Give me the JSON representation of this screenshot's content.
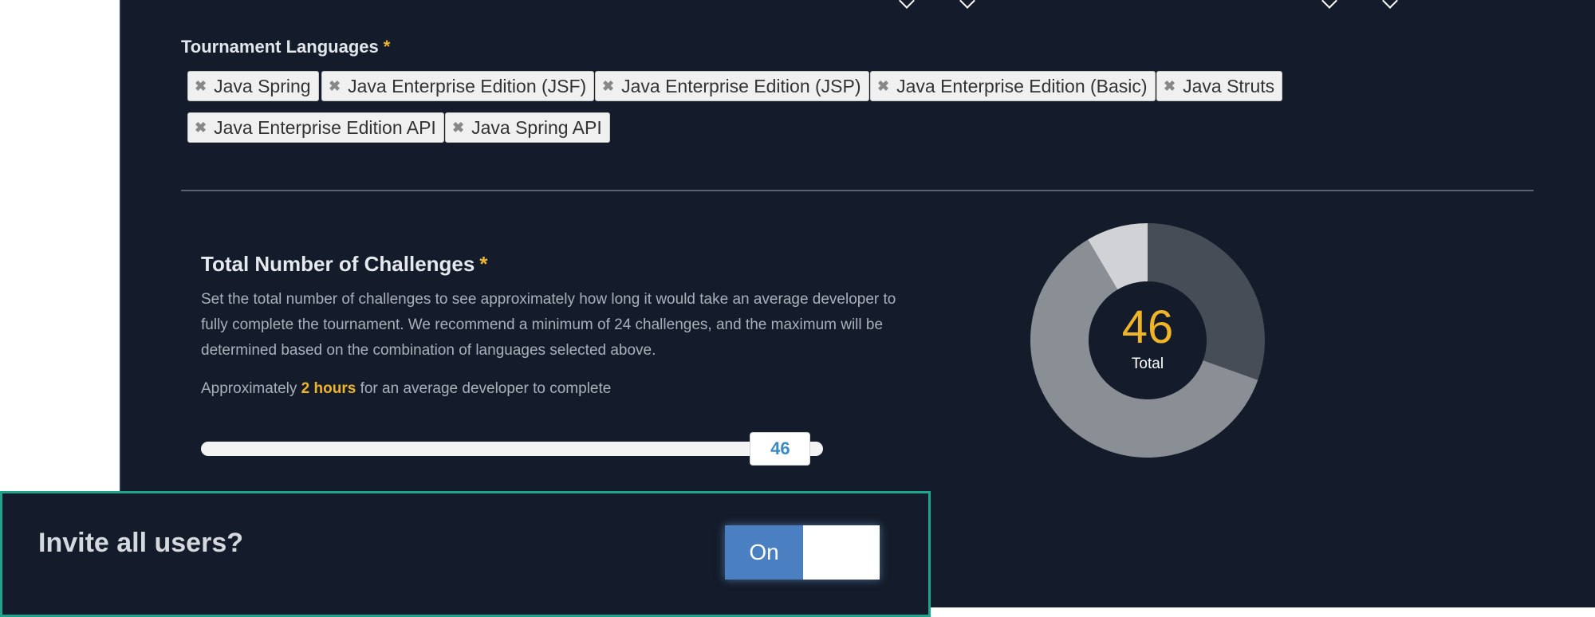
{
  "languages": {
    "label": "Tournament Languages",
    "required_mark": "*",
    "tags": [
      "Java Spring",
      "Java Enterprise Edition (JSF)",
      "Java Enterprise Edition (JSP)",
      "Java Enterprise Edition (Basic)",
      "Java Struts",
      "Java Enterprise Edition API",
      "Java Spring API"
    ],
    "remove_glyph": "✖"
  },
  "challenges": {
    "title": "Total Number of Challenges",
    "required_mark": "*",
    "description": "Set the total number of challenges to see approximately how long it would take an average developer to fully complete the tournament. We recommend a minimum of 24 challenges, and the maximum will be determined based on the combination of languages selected above.",
    "approx_prefix": "Approximately",
    "approx_highlight": "2 hours",
    "approx_suffix": "for an average developer to complete",
    "slider_value": "46",
    "slider_fraction": 0.93
  },
  "donut": {
    "center_value": "46",
    "center_label": "Total",
    "segments": [
      {
        "fraction": 0.305,
        "color": "#464d57"
      },
      {
        "fraction": 0.61,
        "color": "#8a8f96"
      },
      {
        "fraction": 0.085,
        "color": "#d0d2d5"
      }
    ]
  },
  "invite": {
    "label": "Invite all users?",
    "toggle_on_label": "On"
  },
  "colors": {
    "accent": "#f0b429",
    "panel_bg": "#141c2b",
    "toggle_blue": "#4a7fc1",
    "box_border": "#1fa58c"
  }
}
